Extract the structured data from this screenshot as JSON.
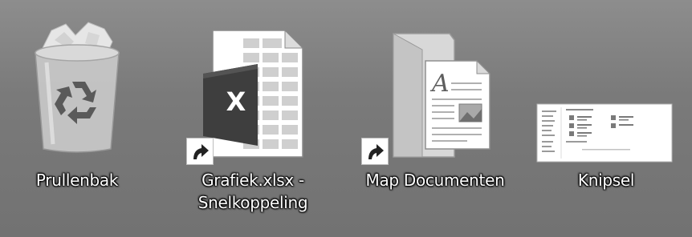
{
  "desktop": {
    "icons": [
      {
        "label": "Prullenbak",
        "icon": "recycle-bin-icon"
      },
      {
        "label": "Grafiek.xlsx -",
        "label_line2": "Snelkoppeling",
        "icon": "excel-file-icon",
        "badge": "X",
        "shortcut": true
      },
      {
        "label": "Map Documenten",
        "icon": "documents-folder-icon",
        "shortcut": true
      },
      {
        "label": "Knipsel",
        "icon": "screenshot-thumbnail-icon"
      }
    ]
  },
  "colors": {
    "background": "#7c7c7c",
    "excel_green": "#3a3a3a",
    "label_text": "#ffffff"
  }
}
